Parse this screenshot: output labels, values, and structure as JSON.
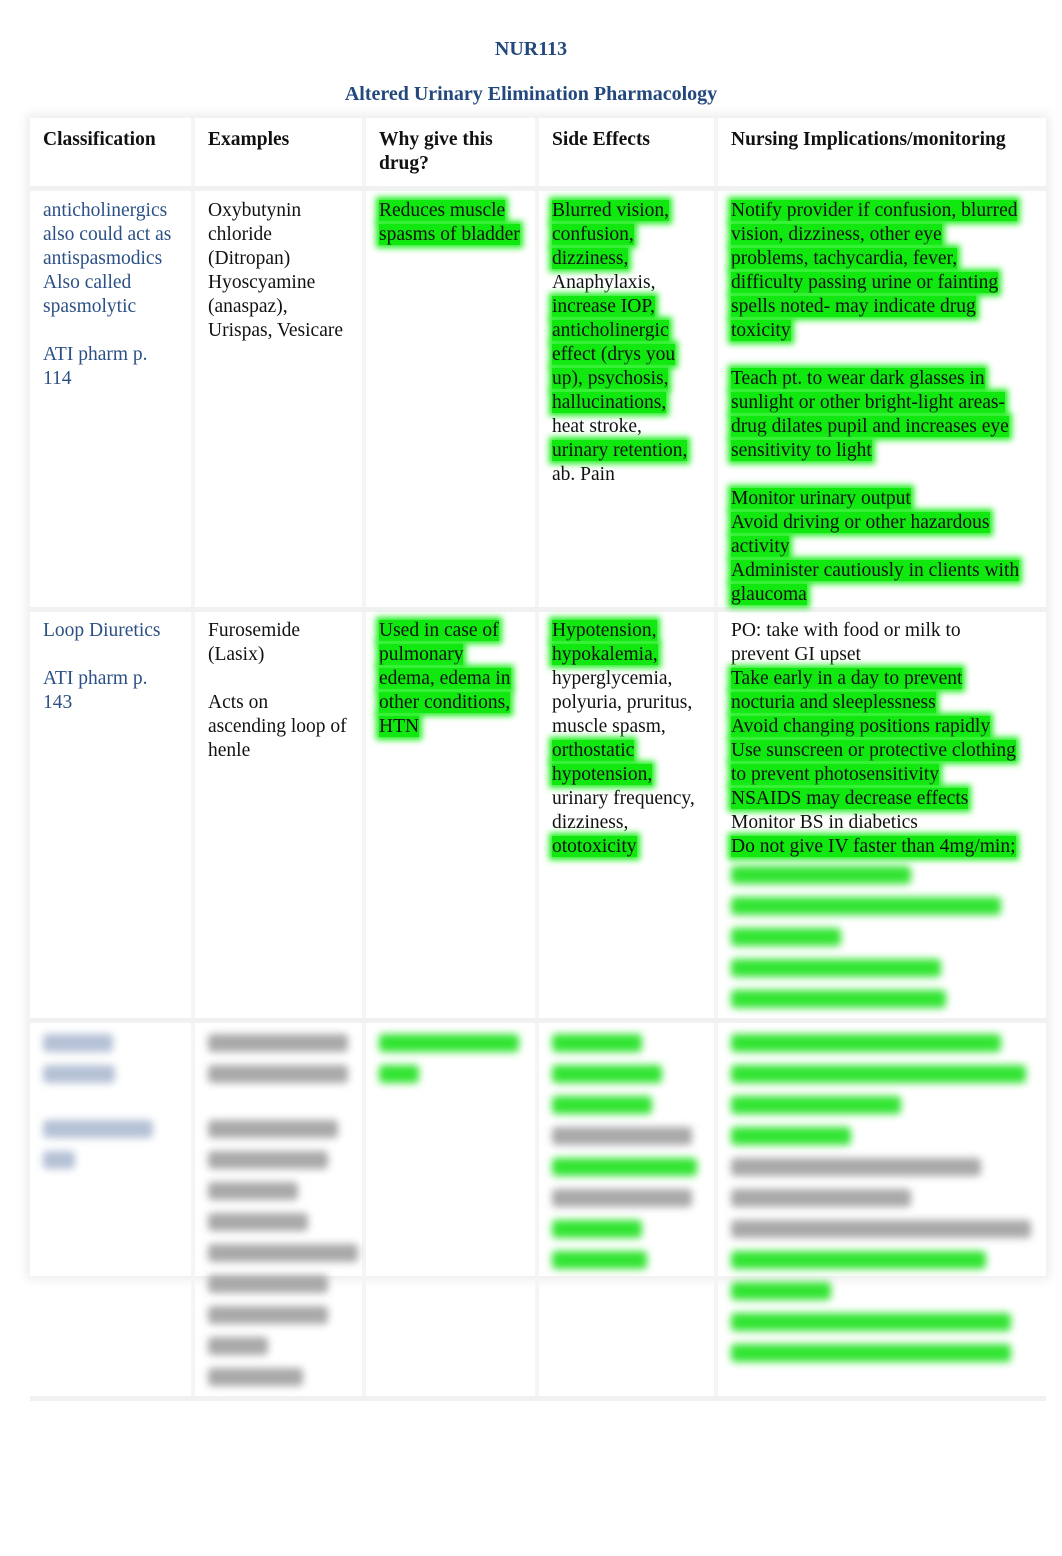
{
  "header": {
    "course_code": "NUR113",
    "title": "Altered Urinary Elimination Pharmacology"
  },
  "colors": {
    "title_blue": "#23487d",
    "classification_blue": "#2b5085",
    "highlight_green": "#10e810"
  },
  "table": {
    "columns": [
      "Classification",
      "Examples",
      "Why give this drug?",
      "Side Effects",
      "Nursing Implications/monitoring"
    ],
    "rows": [
      {
        "classification": {
          "lines": [
            "anticholinergics",
            "also could act as",
            "antispasmodics",
            "Also called",
            "spasmolytic"
          ],
          "reference": [
            "ATI pharm p.",
            "114"
          ]
        },
        "examples": [
          "Oxybutynin",
          "chloride",
          "(Ditropan)",
          "Hyoscyamine",
          "(anaspaz),",
          "Urispas, Vesicare"
        ],
        "why": [
          "Reduces muscle",
          "spasms of bladder"
        ],
        "side_effects": [
          {
            "text": "Blurred vision,",
            "highlight": true
          },
          {
            "text": "confusion,",
            "highlight": true
          },
          {
            "text": "dizziness,",
            "highlight": true
          },
          {
            "text": "Anaphylaxis,",
            "highlight": false
          },
          {
            "text": "increase IOP,",
            "highlight": true
          },
          {
            "text": "anticholinergic",
            "highlight": true
          },
          {
            "text": "effect (drys you",
            "highlight": true
          },
          {
            "text": "up), psychosis,",
            "highlight": true
          },
          {
            "text": "hallucinations,",
            "highlight": true
          },
          {
            "text": "heat stroke,",
            "highlight": false
          },
          {
            "text": "urinary retention,",
            "highlight": true
          },
          {
            "text": "ab. Pain",
            "highlight": false
          }
        ],
        "nursing": [
          [
            "Notify provider if confusion, blurred",
            "vision, dizziness, other eye",
            "problems, tachycardia, fever,",
            "difficulty passing urine or fainting",
            "spells noted- may indicate drug",
            "toxicity"
          ],
          [
            "Teach pt. to wear dark glasses in",
            "sunlight or other bright-light areas-",
            "drug dilates pupil and increases eye",
            "sensitivity to light"
          ],
          [
            "Monitor urinary output",
            "Avoid driving or other hazardous",
            "activity",
            "Administer cautiously in clients with",
            "glaucoma"
          ]
        ]
      },
      {
        "classification": {
          "lines": [
            "Loop Diuretics"
          ],
          "reference": [
            "ATI pharm p.",
            "143"
          ]
        },
        "examples": [
          "Furosemide",
          "(Lasix)"
        ],
        "examples_note": [
          "Acts on",
          "ascending loop of",
          "henle"
        ],
        "why": [
          "Used in case of",
          "pulmonary",
          "edema, edema in",
          "other conditions,",
          "HTN"
        ],
        "side_effects": [
          {
            "text": "Hypotension,",
            "highlight": true
          },
          {
            "text": "hypokalemia,",
            "highlight": true
          },
          {
            "text": "hyperglycemia,",
            "highlight": false
          },
          {
            "text": "polyuria, pruritus,",
            "highlight": false
          },
          {
            "text": "muscle spasm,",
            "highlight": false
          },
          {
            "text": "orthostatic",
            "highlight": true
          },
          {
            "text": "hypotension,",
            "highlight": true
          },
          {
            "text": "urinary frequency,",
            "highlight": false
          },
          {
            "text": "dizziness,",
            "highlight": false
          },
          {
            "text": "ototoxicity",
            "highlight": true
          }
        ],
        "nursing": [
          {
            "text": "PO: take with food or milk to",
            "highlight": false
          },
          {
            "text": "prevent GI upset",
            "highlight": false
          },
          {
            "text": "Take early in a day to prevent",
            "highlight": true
          },
          {
            "text": "nocturia and sleeplessness",
            "highlight": true
          },
          {
            "text": "Avoid changing positions rapidly",
            "highlight": true
          },
          {
            "text": "Use sunscreen or protective clothing",
            "highlight": true
          },
          {
            "text": "to prevent photosensitivity",
            "highlight": true
          },
          {
            "text": "NSAIDS may decrease effects",
            "highlight": true
          },
          {
            "text": "Monitor BS in diabetics",
            "highlight": false
          },
          {
            "text": "Do not give IV faster than 4mg/min;",
            "highlight": true
          }
        ],
        "nursing_obscured": true
      },
      {
        "obscured": true
      }
    ]
  }
}
